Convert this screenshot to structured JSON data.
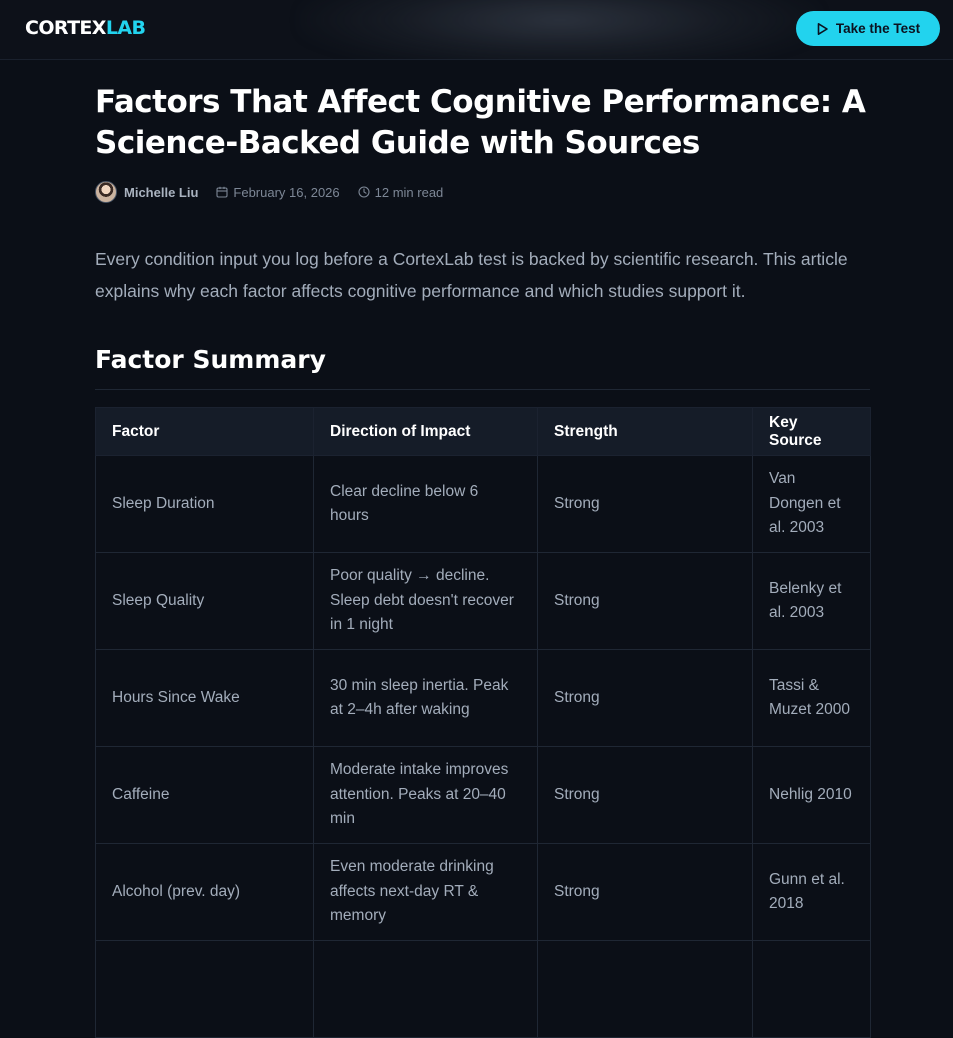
{
  "header": {
    "logo_part1": "CORTEX",
    "logo_part2": "LAB",
    "cta_label": "Take the Test",
    "cta_icon": "play-icon",
    "accent_color": "#22d3ee"
  },
  "article": {
    "title": "Factors That Affect Cognitive Performance: A Science-Backed Guide with Sources",
    "author": "Michelle Liu",
    "date": "February 16, 2026",
    "read_time": "12 min read",
    "lead": "Every condition input you log before a CortexLab test is backed by scientific research. This article explains why each factor affects cognitive performance and which studies support it.",
    "section_title": "Factor Summary"
  },
  "table": {
    "headers": [
      "Factor",
      "Direction of Impact",
      "Strength",
      "Key Source"
    ],
    "rows": [
      [
        "Sleep Duration",
        "Clear decline below 6 hours",
        "Strong",
        "Van Dongen et al. 2003"
      ],
      [
        "Sleep Quality",
        "Poor quality → decline. Sleep debt doesn't recover in 1 night",
        "Strong",
        "Belenky et al. 2003"
      ],
      [
        "Hours Since Wake",
        "30 min sleep inertia. Peak at 2–4h after waking",
        "Strong",
        "Tassi & Muzet 2000"
      ],
      [
        "Caffeine",
        "Moderate intake improves attention. Peaks at 20–40 min",
        "Strong",
        "Nehlig 2010"
      ],
      [
        "Alcohol (prev. day)",
        "Even moderate drinking affects next-day RT & memory",
        "Strong",
        "Gunn et al. 2018"
      ]
    ]
  }
}
